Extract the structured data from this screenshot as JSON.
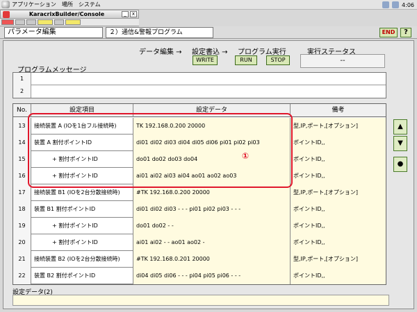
{
  "system_bar": {
    "menus": [
      "アプリケーション",
      "場所",
      "システム"
    ],
    "clock": "4:06"
  },
  "window": {
    "title": "KaracrixBuilder/Console",
    "minimize": "_",
    "close": "x"
  },
  "header": {
    "tab_param": "パラメータ編集",
    "tab_program": "２）通信&警報プログラム",
    "end_button": "END",
    "help_button": "?"
  },
  "flow": {
    "edit_data": "データ編集 →",
    "write_settings": "設定書込 →",
    "program_run": "プログラム実行",
    "exec_status": "実行ステータス",
    "write_button": "WRITE",
    "run_button": "RUN",
    "stop_button": "STOP",
    "status_value": "--"
  },
  "messages": {
    "title": "プログラムメッセージ",
    "rows": [
      {
        "num": "1",
        "text": ""
      },
      {
        "num": "2",
        "text": ""
      }
    ]
  },
  "table": {
    "headers": {
      "no": "No.",
      "item": "設定項目",
      "data": "設定データ",
      "note": "備考"
    },
    "rows": [
      {
        "no": "13",
        "item": "接続装置 A (IOを1台フル接続時)",
        "sub": false,
        "data": "TK 192.168.0.200 20000",
        "note": "型,IP,ポート,[オプション]"
      },
      {
        "no": "14",
        "item": "装置  A 割付ポイントID",
        "sub": false,
        "data": "di01 di02 di03 di04 di05 di06 pi01 pi02 pi03",
        "note": "ポイントID,,"
      },
      {
        "no": "15",
        "item": "+ 割付ポイントID",
        "sub": true,
        "data": "do01 do02 do03 do04",
        "note": "ポイントID,,"
      },
      {
        "no": "16",
        "item": "+ 割付ポイントID",
        "sub": true,
        "data": "ai01 ai02 ai03 ai04 ao01 ao02 ao03",
        "note": "ポイントID,,"
      },
      {
        "no": "17",
        "item": "接続装置 B1 (IOを2台分散接続時)",
        "sub": false,
        "data": "#TK 192.168.0.200 20000",
        "note": "型,IP,ポート,[オプション]"
      },
      {
        "no": "18",
        "item": "装置  B1 割付ポイントID",
        "sub": false,
        "data": "di01 di02 di03 - - -  pi01 pi02 pi03 - - -",
        "note": "ポイントID,,"
      },
      {
        "no": "19",
        "item": "+ 割付ポイントID",
        "sub": true,
        "data": "do01 do02 - -",
        "note": "ポイントID,,"
      },
      {
        "no": "20",
        "item": "+ 割付ポイントID",
        "sub": true,
        "data": "ai01 ai02 - -  ao01 ao02 -",
        "note": "ポイントID,,"
      },
      {
        "no": "21",
        "item": "接続装置 B2 (IOを2台分散接続時)",
        "sub": false,
        "data": "#TK 192.168.0.201 20000",
        "note": "型,IP,ポート,[オプション]"
      },
      {
        "no": "22",
        "item": "装置  B2 割付ポイントID",
        "sub": false,
        "data": "di04 di05 di06 - - -  pi04 pi05 pi06 - - -",
        "note": "ポイントID,,"
      }
    ]
  },
  "annotation": {
    "marker": "①"
  },
  "scroll": {
    "up": "▲",
    "down": "▼",
    "dot": "●"
  },
  "footer": {
    "label": "設定データ(2)",
    "value": ""
  }
}
